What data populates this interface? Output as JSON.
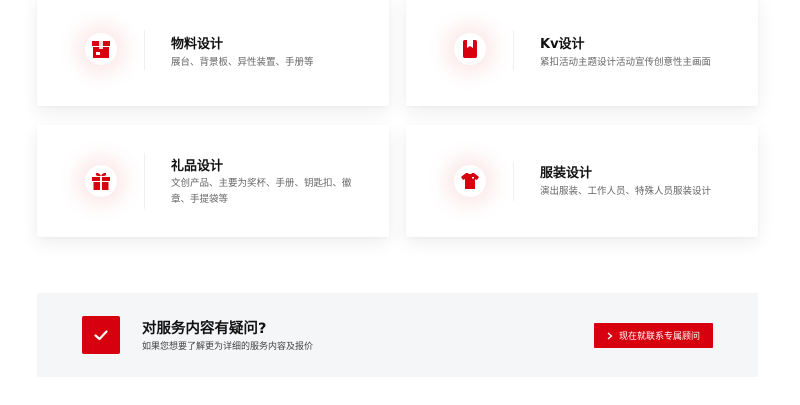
{
  "accent_color": "#d6000f",
  "services": [
    {
      "title": "物料设计",
      "desc": "展台、背景板、异性装置、手册等",
      "icon": "box-icon"
    },
    {
      "title": "Kv设计",
      "desc": "紧扣活动主题设计活动宣传创意性主画面",
      "icon": "bookmark-book-icon"
    },
    {
      "title": "礼品设计",
      "desc": "文创产品、主要为奖杯、手册、钥匙扣、徽章、手提袋等",
      "icon": "gift-icon"
    },
    {
      "title": "服装设计",
      "desc": "演出服装、工作人员、特殊人员服装设计",
      "icon": "tshirt-icon"
    }
  ],
  "cta": {
    "icon": "check-icon",
    "title": "对服务内容有疑问?",
    "subtitle": "如果您想要了解更为详细的服务内容及报价",
    "button_label": "现在就联系专属顾问",
    "button_icon": "chevron-right-icon"
  }
}
